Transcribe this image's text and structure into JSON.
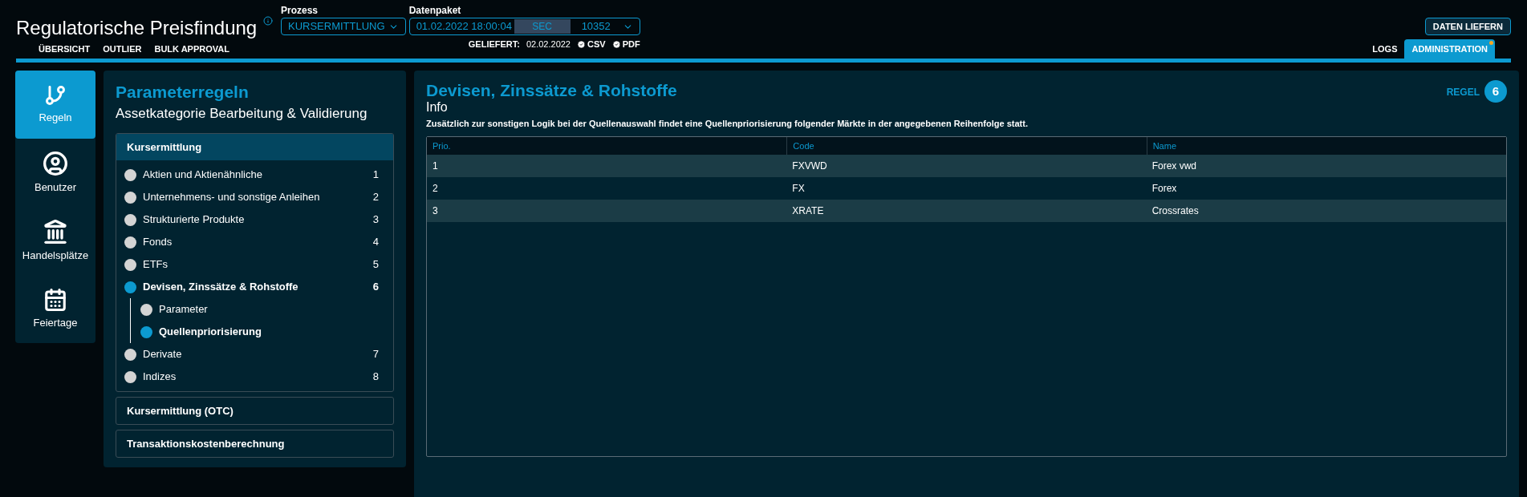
{
  "header": {
    "title": "Regulatorische Preisfindung",
    "process": {
      "label": "Prozess",
      "value": "KURSERMITTLUNG"
    },
    "data_package": {
      "label": "Datenpaket",
      "date": "01.02.2022 18:00:04",
      "tag": "SEC",
      "number": "10352"
    },
    "delivered": {
      "label": "GELIEFERT:",
      "date": "02.02.2022",
      "files": [
        {
          "label": "CSV",
          "checked": true
        },
        {
          "label": "PDF",
          "checked": true
        }
      ]
    },
    "action_button": "DATEN LIEFERN",
    "nav_left": [
      {
        "label": "ÜBERSICHT",
        "selected": false
      },
      {
        "label": "OUTLIER",
        "selected": false
      },
      {
        "label": "BULK APPROVAL",
        "selected": false
      }
    ],
    "nav_right": [
      {
        "label": "LOGS",
        "selected": false,
        "notification": false
      },
      {
        "label": "ADMINISTRATION",
        "selected": true,
        "notification": true
      }
    ]
  },
  "sidebar": {
    "items": [
      {
        "kind": "rules",
        "label": "Regeln",
        "selected": true
      },
      {
        "kind": "user",
        "label": "Benutzer",
        "selected": false
      },
      {
        "kind": "market",
        "label": "Handelsplätze",
        "selected": false
      },
      {
        "kind": "calendar",
        "label": "Feiertage",
        "selected": false
      }
    ]
  },
  "rules_panel": {
    "title": "Parameterregeln",
    "subtitle": "Assetkategorie Bearbeitung & Validierung",
    "groups": [
      {
        "title": "Kursermittlung",
        "expanded": true,
        "items": [
          {
            "label": "Aktien und Aktienähnliche",
            "number": "1",
            "selected": false
          },
          {
            "label": "Unternehmens- und sonstige Anleihen",
            "number": "2",
            "selected": false
          },
          {
            "label": "Strukturierte Produkte",
            "number": "3",
            "selected": false
          },
          {
            "label": "Fonds",
            "number": "4",
            "selected": false
          },
          {
            "label": "ETFs",
            "number": "5",
            "selected": false
          },
          {
            "label": "Devisen, Zinssätze & Rohstoffe",
            "number": "6",
            "selected": true,
            "children": [
              {
                "label": "Parameter",
                "selected": false
              },
              {
                "label": "Quellenpriorisierung",
                "selected": true
              }
            ]
          },
          {
            "label": "Derivate",
            "number": "7",
            "selected": false
          },
          {
            "label": "Indizes",
            "number": "8",
            "selected": false
          }
        ]
      },
      {
        "title": "Kursermittlung (OTC)",
        "expanded": false
      },
      {
        "title": "Transaktionskostenberechnung",
        "expanded": false
      }
    ]
  },
  "detail": {
    "title": "Devisen, Zinssätze & Rohstoffe",
    "badge_label": "REGEL",
    "badge_number": "6",
    "info_heading": "Info",
    "description": "Zusätzlich zur sonstigen Logik bei der Quellenauswahl findet eine Quellenpriorisierung folgender Märkte in der angegebenen Reihenfolge statt.",
    "table": {
      "columns": [
        "Prio.",
        "Code",
        "Name"
      ],
      "rows": [
        [
          "1",
          "FXVWD",
          "Forex vwd"
        ],
        [
          "2",
          "FX",
          "Forex"
        ],
        [
          "3",
          "XRATE",
          "Crossrates"
        ]
      ]
    }
  }
}
